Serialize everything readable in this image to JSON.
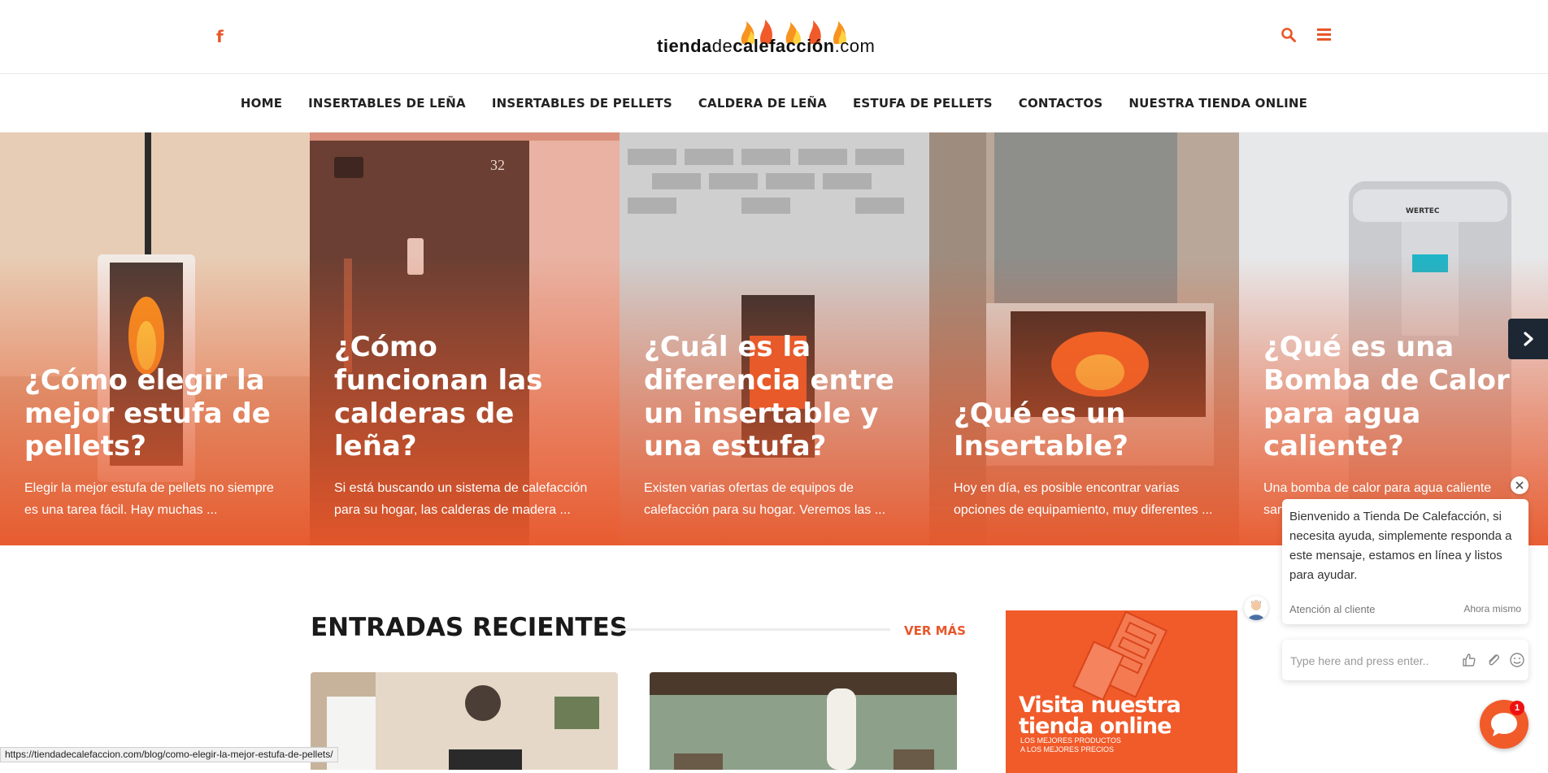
{
  "header": {
    "logo_text_left": "tienda",
    "logo_text_mid": "de",
    "logo_text_brand": "calefacción",
    "logo_text_tld": ".com",
    "social_icon": "facebook-icon",
    "search_icon": "search-icon",
    "menu_icon": "hamburger-icon",
    "accent_color": "#e8572a"
  },
  "nav": {
    "items": [
      "HOME",
      "INSERTABLES DE LEÑA",
      "INSERTABLES DE PELLETS",
      "CALDERA DE LEÑA",
      "ESTUFA DE PELLETS",
      "CONTACTOS",
      "NUESTRA TIENDA ONLINE"
    ]
  },
  "slides": [
    {
      "title": "¿Cómo elegir la mejor estufa de pellets?",
      "excerpt": "Elegir la mejor estufa de pellets no siempre es una tarea fácil. Hay muchas ..."
    },
    {
      "title": "¿Cómo funcionan las calderas de leña?",
      "excerpt": "Si está buscando un sistema de calefacción para su hogar, las calderas de madera ..."
    },
    {
      "title": "¿Cuál es la diferencia entre un insertable y una estufa?",
      "excerpt": "Existen varias ofertas de equipos de calefacción para su hogar. Veremos las ..."
    },
    {
      "title": "¿Qué es un Insertable?",
      "excerpt": "Hoy en día, es posible encontrar varias opciones de equipamiento, muy diferentes ..."
    },
    {
      "title": "¿Qué es una Bomba de Calor para agua caliente?",
      "excerpt": "Una bomba de calor para agua caliente sani..."
    }
  ],
  "slide_decor": {
    "stove_number": "32",
    "brand_badge": "WERTEC"
  },
  "recent": {
    "title": "ENTRADAS RECIENTES",
    "more_label": "VER MÁS"
  },
  "promo": {
    "title_line1": "Visita nuestra",
    "title_line2": "tienda online",
    "sub_line1": "LOS MEJORES PRODUCTOS",
    "sub_line2": "A LOS MEJORES PRECIOS"
  },
  "status_bar": {
    "url": "https://tiendadecalefaccion.com/blog/como-elegir-la-mejor-estufa-de-pellets/"
  },
  "chat": {
    "message": "Bienvenido a Tienda De Calefacción, si necesita ayuda, simplemente responda a este mensaje, estamos en línea y listos para ayudar.",
    "agent": "Atención al cliente",
    "time": "Ahora mismo",
    "input_placeholder": "Type here and press enter..",
    "badge_count": "1"
  }
}
